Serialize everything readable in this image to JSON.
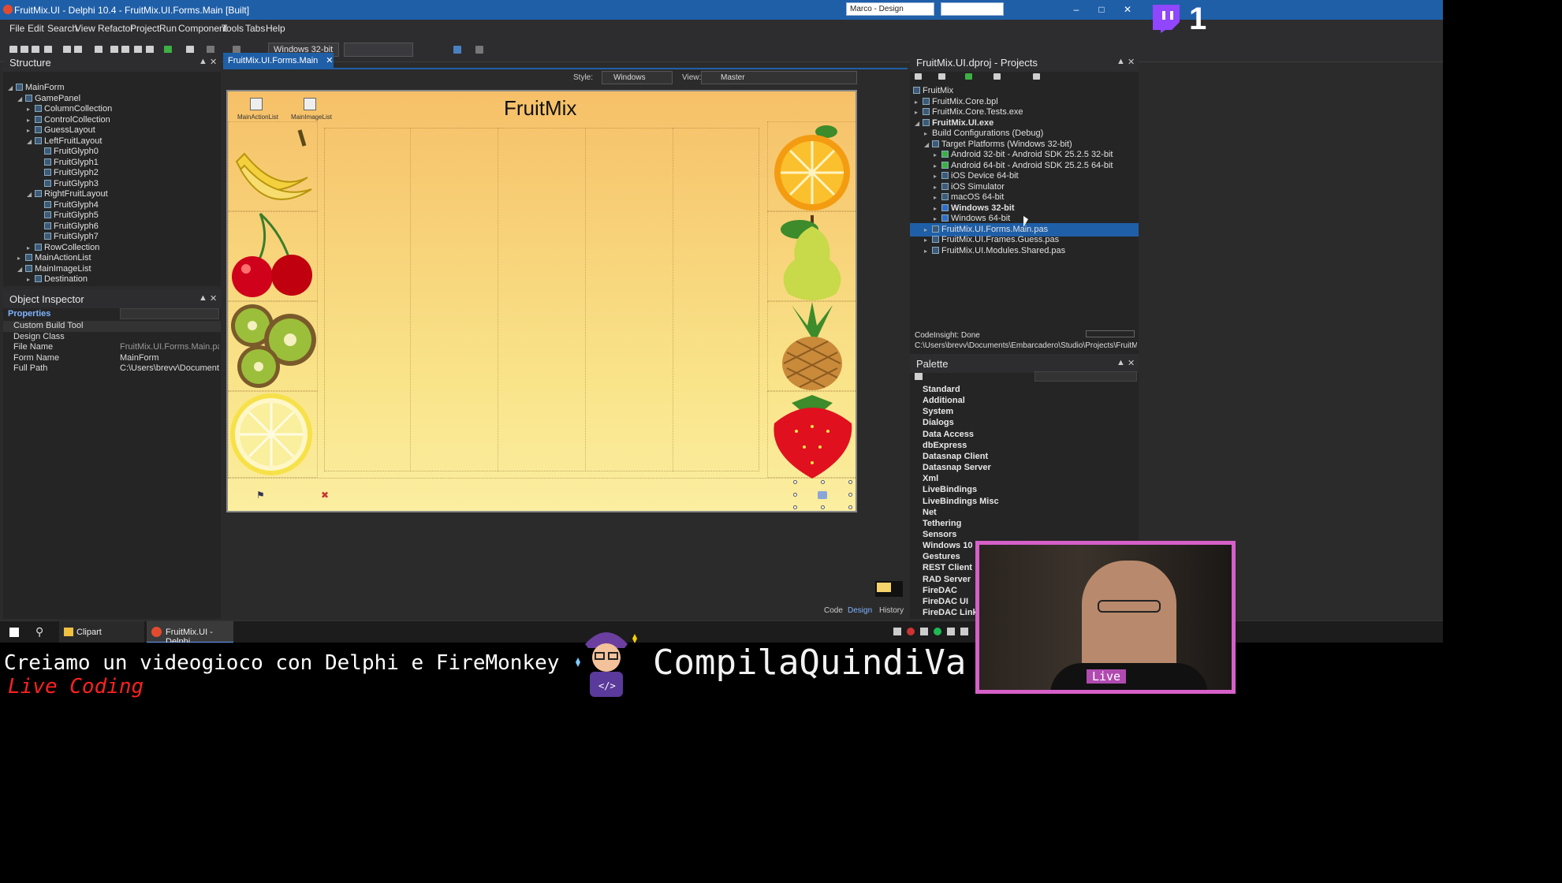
{
  "window": {
    "title": "FruitMix.UI - Delphi 10.4 - FruitMix.UI.Forms.Main [Built]",
    "layout_combo": "Marco - Design"
  },
  "menu": [
    "File",
    "Edit",
    "Search",
    "View",
    "Refactor",
    "Project",
    "Run",
    "Component",
    "Tools",
    "Tabs",
    "Help"
  ],
  "toolbar": {
    "platform": "Windows 32-bit"
  },
  "structure": {
    "title": "Structure",
    "nodes": [
      "MainForm",
      "GamePanel",
      "ColumnCollection",
      "ControlCollection",
      "GuessLayout",
      "LeftFruitLayout",
      "FruitGlyph0",
      "FruitGlyph1",
      "FruitGlyph2",
      "FruitGlyph3",
      "RightFruitLayout",
      "FruitGlyph4",
      "FruitGlyph5",
      "FruitGlyph6",
      "FruitGlyph7",
      "RowCollection",
      "MainActionList",
      "MainImageList",
      "Destination"
    ]
  },
  "inspector": {
    "title": "Object Inspector",
    "tab": "Properties",
    "props": [
      {
        "name": "Custom Build Tool",
        "value": ""
      },
      {
        "name": "Design Class",
        "value": ""
      },
      {
        "name": "File Name",
        "value": "FruitMix.UI.Forms.Main.pas"
      },
      {
        "name": "Form Name",
        "value": "MainForm"
      },
      {
        "name": "Full Path",
        "value": "C:\\Users\\brevv\\Documents\\Embar"
      }
    ]
  },
  "designer": {
    "tab": "FruitMix.UI.Forms.Main",
    "style_label": "Style:",
    "style_value": "Windows",
    "view_label": "View:",
    "view_value": "Master",
    "form_title": "FruitMix",
    "nonvisual": [
      "MainActionList",
      "MainImageList"
    ],
    "bottom_tabs": [
      "Code",
      "Design",
      "History"
    ]
  },
  "projects": {
    "title": "FruitMix.UI.dproj - Projects",
    "items": [
      "FruitMix",
      "FruitMix.Core.bpl",
      "FruitMix.Core.Tests.exe",
      "FruitMix.UI.exe",
      "Build Configurations (Debug)",
      "Target Platforms (Windows 32-bit)",
      "Android 32-bit - Android SDK 25.2.5 32-bit",
      "Android 64-bit - Android SDK 25.2.5 64-bit",
      "iOS Device 64-bit",
      "iOS Simulator",
      "macOS 64-bit",
      "Windows 32-bit",
      "Windows 64-bit",
      "FruitMix.UI.Forms.Main.pas",
      "FruitMix.UI.Frames.Guess.pas",
      "FruitMix.UI.Modules.Shared.pas"
    ],
    "codeinsight": "CodeInsight: Done",
    "path": "C:\\Users\\brevv\\Documents\\Embarcadero\\Studio\\Projects\\FruitMix\\Frui..."
  },
  "palette": {
    "title": "Palette",
    "categories": [
      "Standard",
      "Additional",
      "System",
      "Dialogs",
      "Data Access",
      "dbExpress",
      "Datasnap Client",
      "Datasnap Server",
      "Xml",
      "LiveBindings",
      "LiveBindings Misc",
      "Net",
      "Tethering",
      "Sensors",
      "Windows 10",
      "Gestures",
      "REST Client",
      "RAD Server",
      "FireDAC",
      "FireDAC UI",
      "FireDAC Links"
    ]
  },
  "taskbar": {
    "items": [
      "Clipart",
      "FruitMix.UI - Delphi..."
    ]
  },
  "stream": {
    "title": "Creiamo un videogioco con Delphi e FireMonkey",
    "subtitle": "Live Coding",
    "channel": "CompilaQuindiVa",
    "live": "Live",
    "counter": "1",
    "colors": {
      "accent": "#1f5fa8",
      "webcam_border": "#d65fc8",
      "subtitle": "#ff2020"
    }
  }
}
